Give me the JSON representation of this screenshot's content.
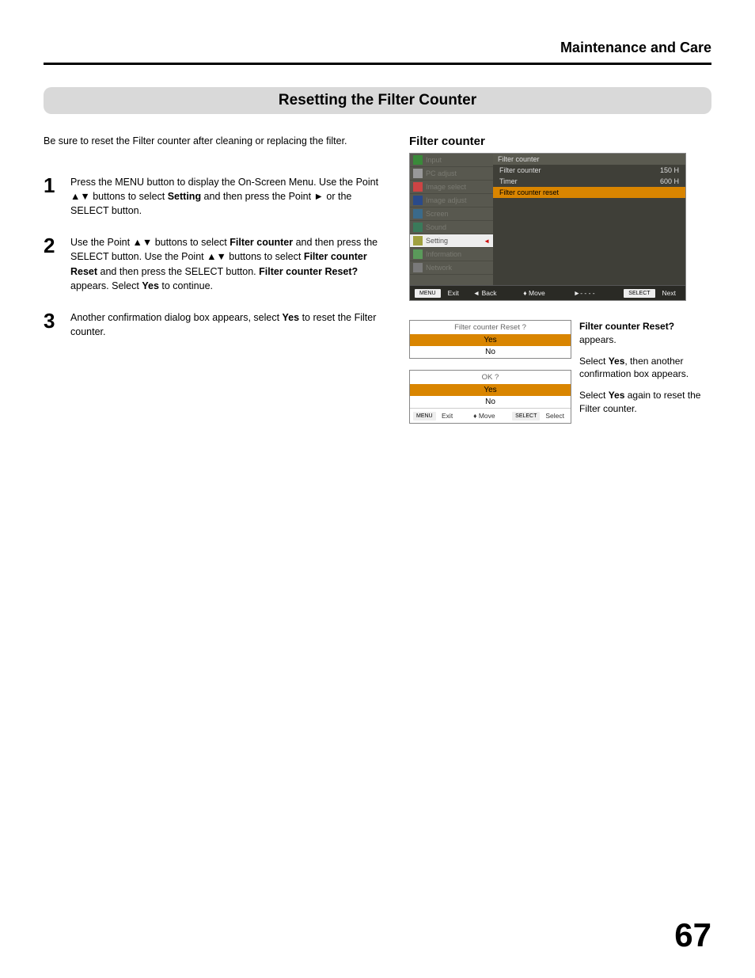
{
  "header": {
    "chapter": "Maintenance and Care"
  },
  "section": {
    "title": "Resetting the Filter Counter"
  },
  "intro": "Be sure to reset the Filter counter after cleaning or replacing the filter.",
  "steps": [
    {
      "num": "1",
      "html": "Press the MENU button to display the On-Screen Menu. Use the Point ▲▼ buttons to select <b>Setting</b> and then press the Point ► or the SELECT button."
    },
    {
      "num": "2",
      "html": "Use the Point ▲▼ buttons to select <b>Filter counter</b> and then press the SELECT button. Use the Point ▲▼ buttons to select <b>Filter counter Reset</b> and then press the SELECT button. <b>Filter counter Reset?</b> appears. Select <b>Yes</b> to continue."
    },
    {
      "num": "3",
      "html": "Another confirmation dialog box appears, select <b>Yes</b> to reset the Filter counter."
    }
  ],
  "right": {
    "heading": "Filter counter",
    "osd": {
      "menu_items": [
        {
          "label": "Input",
          "icon": "input",
          "sel": false
        },
        {
          "label": "PC adjust",
          "icon": "pc",
          "sel": false
        },
        {
          "label": "Image select",
          "icon": "isel",
          "sel": false
        },
        {
          "label": "Image adjust",
          "icon": "iadj",
          "sel": false
        },
        {
          "label": "Screen",
          "icon": "screen",
          "sel": false
        },
        {
          "label": "Sound",
          "icon": "sound",
          "sel": false
        },
        {
          "label": "Setting",
          "icon": "setting",
          "sel": true
        },
        {
          "label": "Information",
          "icon": "info",
          "sel": false
        },
        {
          "label": "Network",
          "icon": "net",
          "sel": false
        }
      ],
      "panel_title": "Filter counter",
      "rows": [
        {
          "label": "Filter counter",
          "value": "150 H",
          "hl": false
        },
        {
          "label": "Timer",
          "value": "600 H",
          "hl": false
        },
        {
          "label": "Filter counter reset",
          "value": "",
          "hl": true
        }
      ],
      "footer": {
        "exit_tag": "MENU",
        "exit": "Exit",
        "back": "◄ Back",
        "move": "♦ Move",
        "next_arrow": "►- - - -",
        "next_tag": "SELECT",
        "next": "Next"
      }
    },
    "dialog1": {
      "title": "Filter counter  Reset ?",
      "opt_hl": "Yes",
      "opt": "No"
    },
    "dialog2": {
      "title": "OK ?",
      "opt_hl": "Yes",
      "opt": "No"
    },
    "dialog_footer": {
      "exit_tag": "MENU",
      "exit": "Exit",
      "move": "♦ Move",
      "select_tag": "SELECT",
      "select": "Select"
    },
    "side": {
      "p1_html": "<b>Filter counter Reset?</b> appears.",
      "p2_html": "Select <b>Yes</b>, then another confirmation box appears.",
      "p3_html": "Select <b>Yes</b> again to reset the Filter counter."
    }
  },
  "page_num": "67"
}
